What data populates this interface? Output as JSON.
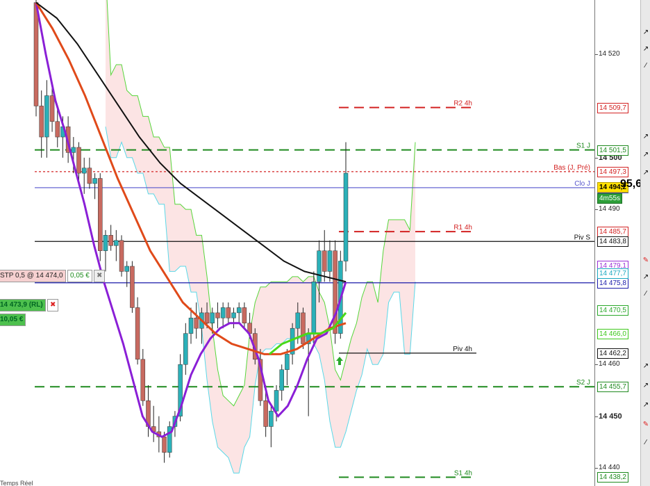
{
  "chart_data": {
    "type": "candlestick",
    "ylim": [
      14436.5,
      14530.5
    ],
    "y_ticks": [
      14440,
      14450,
      14460,
      14490,
      14500,
      14520
    ],
    "bold_ticks": [
      14450,
      14500
    ],
    "candles": [
      [
        14530,
        14532,
        14508,
        14510
      ],
      [
        14510,
        14513,
        14500,
        14504
      ],
      [
        14504,
        14515,
        14500,
        14512
      ],
      [
        14512,
        14514,
        14505,
        14507
      ],
      [
        14507,
        14510,
        14502,
        14504
      ],
      [
        14504,
        14508,
        14500,
        14506
      ],
      [
        14506,
        14508,
        14499,
        14501
      ],
      [
        14501,
        14504,
        14497,
        14502
      ],
      [
        14502,
        14503,
        14495,
        14497
      ],
      [
        14497,
        14500,
        14493,
        14498
      ],
      [
        14498,
        14500,
        14494,
        14495
      ],
      [
        14495,
        14497,
        14492,
        14496
      ],
      [
        14496,
        14497,
        14480,
        14482
      ],
      [
        14482,
        14486,
        14478,
        14485
      ],
      [
        14485,
        14487,
        14482,
        14483
      ],
      [
        14483,
        14486,
        14480,
        14484
      ],
      [
        14484,
        14485,
        14477,
        14478
      ],
      [
        14478,
        14480,
        14475,
        14479
      ],
      [
        14479,
        14480,
        14470,
        14471
      ],
      [
        14471,
        14473,
        14460,
        14461
      ],
      [
        14461,
        14463,
        14452,
        14453
      ],
      [
        14453,
        14456,
        14446,
        14448
      ],
      [
        14448,
        14452,
        14445,
        14447
      ],
      [
        14447,
        14450,
        14443,
        14446
      ],
      [
        14446,
        14447,
        14441,
        14443
      ],
      [
        14443,
        14449,
        14442,
        14448
      ],
      [
        14448,
        14451,
        14446,
        14450
      ],
      [
        14450,
        14462,
        14449,
        14460
      ],
      [
        14460,
        14468,
        14458,
        14466
      ],
      [
        14466,
        14471,
        14464,
        14469
      ],
      [
        14469,
        14472,
        14465,
        14467
      ],
      [
        14467,
        14471,
        14464,
        14470
      ],
      [
        14470,
        14472,
        14467,
        14468
      ],
      [
        14468,
        14471,
        14466,
        14470
      ],
      [
        14470,
        14472,
        14467,
        14469
      ],
      [
        14469,
        14472,
        14467,
        14471
      ],
      [
        14471,
        14472,
        14468,
        14469
      ],
      [
        14469,
        14471,
        14467,
        14470
      ],
      [
        14470,
        14472,
        14468,
        14471
      ],
      [
        14471,
        14472,
        14467,
        14468
      ],
      [
        14468,
        14470,
        14465,
        14466
      ],
      [
        14466,
        14467,
        14460,
        14461
      ],
      [
        14461,
        14463,
        14452,
        14453
      ],
      [
        14453,
        14456,
        14446,
        14448
      ],
      [
        14448,
        14452,
        14444,
        14451
      ],
      [
        14451,
        14456,
        14449,
        14455
      ],
      [
        14455,
        14460,
        14453,
        14459
      ],
      [
        14459,
        14463,
        14456,
        14462
      ],
      [
        14462,
        14468,
        14460,
        14467
      ],
      [
        14467,
        14472,
        14464,
        14470
      ],
      [
        14470,
        14471,
        14463,
        14464
      ],
      [
        14464,
        14467,
        14450,
        14466
      ],
      [
        14466,
        14478,
        14464,
        14476
      ],
      [
        14476,
        14484,
        14472,
        14482
      ],
      [
        14482,
        14486,
        14476,
        14478
      ],
      [
        14478,
        14484,
        14476,
        14482
      ],
      [
        14482,
        14484,
        14464,
        14466
      ],
      [
        14466,
        14482,
        14465,
        14480
      ],
      [
        14480,
        14503,
        14478,
        14497
      ]
    ],
    "series": [
      {
        "name": "",
        "color": "#8a1fd6",
        "values": [
          14530,
          14520,
          14511,
          14505,
          14498,
          14491,
          14483,
          14476,
          14470,
          14464,
          14457,
          14450,
          14447,
          14446,
          14447,
          14452,
          14458,
          14462,
          14465,
          14467,
          14468,
          14468,
          14466,
          14461,
          14453,
          14450,
          14452,
          14456,
          14461,
          14465,
          14466,
          14470,
          14476
        ]
      },
      {
        "name": "",
        "color": "#e04a1a",
        "values": [
          14530,
          14525,
          14519,
          14512,
          14504,
          14496,
          14489,
          14482,
          14477,
          14472,
          14469,
          14466,
          14464,
          14463,
          14462,
          14462,
          14463,
          14465,
          14467,
          14468
        ]
      },
      {
        "name": "",
        "color": "#111111",
        "values": [
          14530,
          14527,
          14522,
          14516,
          14510,
          14504,
          14499,
          14495,
          14492,
          14489,
          14486,
          14483,
          14480,
          14478,
          14477,
          14476
        ]
      },
      {
        "name": "",
        "color": "#49d818",
        "values": [
          14462,
          14464,
          14465,
          14466,
          14466,
          14467,
          14470
        ]
      }
    ],
    "levels": [
      {
        "name": "R2 4h",
        "value": 14509.7,
        "color": "#d32222",
        "label": "14 509,7",
        "style": "dash"
      },
      {
        "name": "S1 J",
        "value": 14501.5,
        "color": "#1f8a1f",
        "label": "14 501,5",
        "style": "dash"
      },
      {
        "name": "Bas (J, Pré)",
        "value": 14497.3,
        "color": "#d32222",
        "label": "14 497,3",
        "style": "dot"
      },
      {
        "name": "Clo J",
        "value": 14494.2,
        "color": "#5555cc",
        "label": "14 494,2",
        "style": "solid"
      },
      {
        "name": "R1 4h",
        "value": 14485.7,
        "color": "#d32222",
        "label": "14 485,7",
        "style": "dash"
      },
      {
        "name": "Piv S",
        "value": 14483.8,
        "color": "#111111",
        "label": "14 483,8",
        "style": "solid"
      },
      {
        "name": "",
        "value": 14475.8,
        "color": "#1a1aaa",
        "label": "14 475,8",
        "style": "solid"
      },
      {
        "name": "Piv 4h",
        "value": 14462.2,
        "color": "#111111",
        "label": "14 462,2",
        "style": "solid"
      },
      {
        "name": "S2 J",
        "value": 14455.7,
        "color": "#1f8a1f",
        "label": "14 455,7",
        "style": "dash"
      },
      {
        "name": "S1 4h",
        "value": 14438.2,
        "color": "#1f8a1f",
        "label": "14 438,2",
        "style": "dash"
      }
    ],
    "axis_tags": [
      {
        "value": 14479.1,
        "label": "14 479,1",
        "color": "#9a2fd6"
      },
      {
        "value": 14477.7,
        "label": "14 477,7",
        "color": "#19a8c0"
      },
      {
        "value": 14470.5,
        "label": "14 470,5",
        "color": "#2ba82b"
      },
      {
        "value": 14466.0,
        "label": "14 466,0",
        "color": "#3ec81c"
      }
    ],
    "current_price": {
      "label_main": "14 494,2",
      "label_big": "95,6",
      "timer": "4m55s"
    }
  },
  "axis": {
    "labels": [
      "14 520",
      "14 500",
      "14 490",
      "14 460",
      "14 450",
      "14 440"
    ]
  },
  "orders": {
    "stop_label": "STP  0,5 @ 14 474,0",
    "stop_pnl": "0,05 €",
    "stop_close": "✖",
    "limit_label": "14 473,9 (RL)",
    "limit_pnl": "10,05 €",
    "limit_close": "✖"
  },
  "footer": {
    "text": "Temps Réel"
  }
}
